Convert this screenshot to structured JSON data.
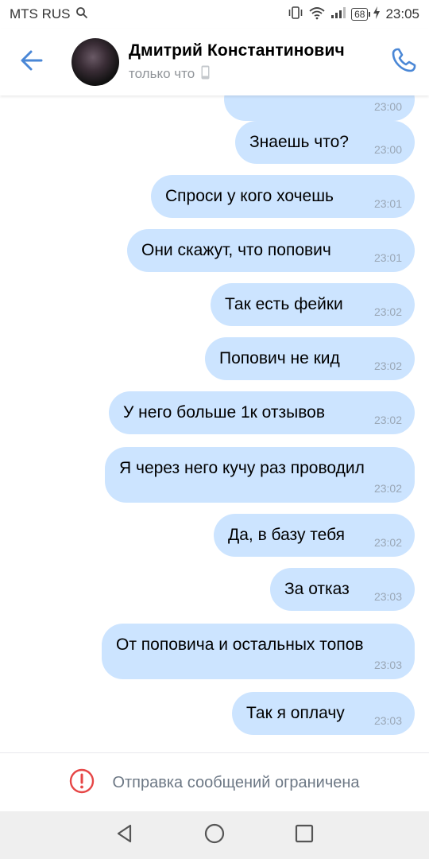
{
  "status_bar": {
    "carrier": "MTS RUS",
    "battery": "68",
    "time": "23:05"
  },
  "header": {
    "name": "Дмитрий Константинович",
    "status": "только что",
    "accent_color": "#4a87d6"
  },
  "messages": [
    {
      "text": "",
      "time": "23:00"
    },
    {
      "text": "Знаешь что?",
      "time": "23:00"
    },
    {
      "text": "Спроси у кого хочешь",
      "time": "23:01"
    },
    {
      "text": "Они скажут, что попович",
      "time": "23:01"
    },
    {
      "text": "Так есть фейки",
      "time": "23:02"
    },
    {
      "text": "Попович не кид",
      "time": "23:02"
    },
    {
      "text": "У него больше 1к отзывов",
      "time": "23:02"
    },
    {
      "text": "Я через него кучу раз проводил",
      "time": "23:02"
    },
    {
      "text": "Да, в базу тебя",
      "time": "23:02"
    },
    {
      "text": "За отказ",
      "time": "23:03"
    },
    {
      "text": "От поповича и остальных топов",
      "time": "23:03"
    },
    {
      "text": "Так я оплачу",
      "time": "23:03"
    }
  ],
  "restriction": {
    "text": "Отправка сообщений ограничена",
    "icon": "exclamation-circle-icon",
    "icon_color": "#e64646"
  },
  "nav_bar": {
    "buttons": [
      "back-triangle-icon",
      "home-circle-icon",
      "recents-square-icon"
    ]
  }
}
